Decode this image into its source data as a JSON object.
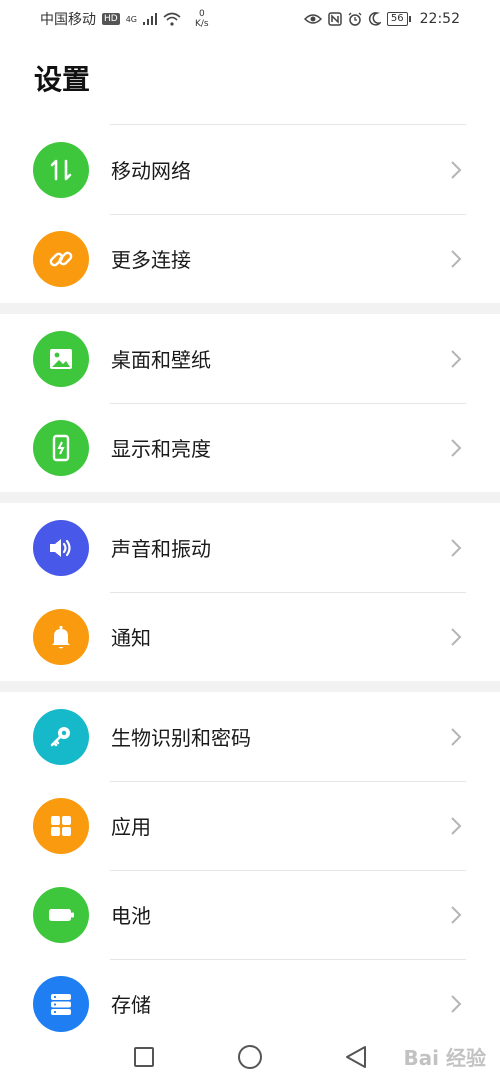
{
  "status_bar": {
    "carrier": "中国移动",
    "hd": "HD",
    "network": "4G",
    "speed_value": "0",
    "speed_unit": "K/s",
    "battery": "56",
    "time": "22:52"
  },
  "page": {
    "title": "设置"
  },
  "colors": {
    "green": "#3ec73c",
    "orange": "#f99a0f",
    "blue": "#4858e8",
    "cyan": "#16b9c9",
    "storage_blue": "#1e7ef2",
    "separator": "#f2f2f2",
    "chevron": "#b5b5b5"
  },
  "groups": [
    {
      "items": [
        {
          "label": "移动网络",
          "icon": "mobile-data-icon",
          "color": "#3ec73c"
        },
        {
          "label": "更多连接",
          "icon": "link-icon",
          "color": "#f99a0f"
        }
      ]
    },
    {
      "items": [
        {
          "label": "桌面和壁纸",
          "icon": "wallpaper-icon",
          "color": "#3ec73c"
        },
        {
          "label": "显示和亮度",
          "icon": "display-icon",
          "color": "#3ec73c"
        }
      ]
    },
    {
      "items": [
        {
          "label": "声音和振动",
          "icon": "sound-icon",
          "color": "#4858e8"
        },
        {
          "label": "通知",
          "icon": "bell-icon",
          "color": "#f99a0f"
        }
      ]
    },
    {
      "items": [
        {
          "label": "生物识别和密码",
          "icon": "key-icon",
          "color": "#16b9c9"
        },
        {
          "label": "应用",
          "icon": "apps-icon",
          "color": "#f99a0f"
        },
        {
          "label": "电池",
          "icon": "battery-icon",
          "color": "#3ec73c"
        },
        {
          "label": "存储",
          "icon": "storage-icon",
          "color": "#1e7ef2"
        }
      ]
    }
  ],
  "watermark": "Bai 经验"
}
